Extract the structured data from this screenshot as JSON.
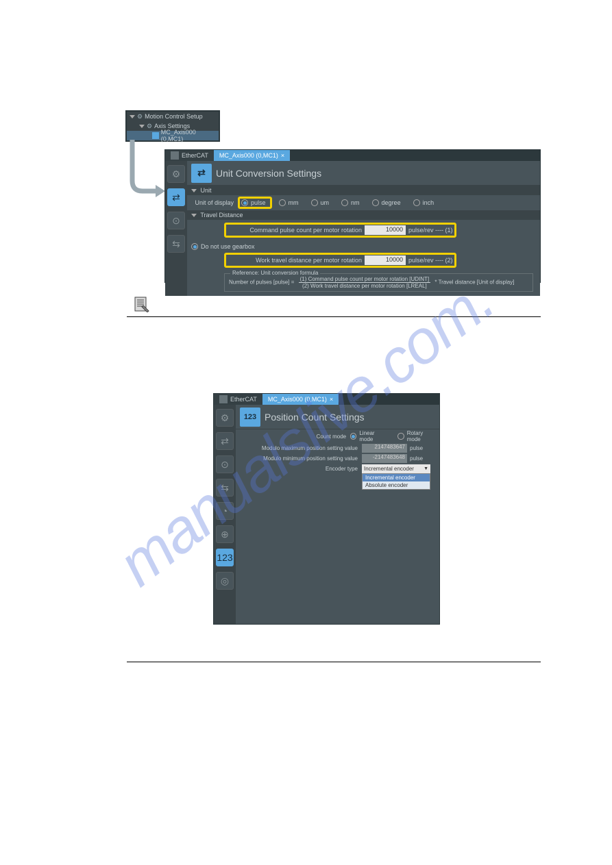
{
  "watermark": "manualslive.com.",
  "tree": {
    "motion_control": "Motion Control Setup",
    "axis_settings": "Axis Settings",
    "axis_node": "MC_Axis000 (0,MC1)"
  },
  "tabs": {
    "ethercat": "EtherCAT",
    "axis": "MC_Axis000 (0,MC1)",
    "close": "×"
  },
  "panel1": {
    "title": "Unit Conversion Settings",
    "section_unit": "Unit",
    "unit_of_display": "Unit of display",
    "radios": {
      "pulse": "pulse",
      "mm": "mm",
      "um": "um",
      "nm": "nm",
      "degree": "degree",
      "inch": "inch"
    },
    "section_travel": "Travel Distance",
    "cmd_pulse_label": "Command pulse count per motor rotation",
    "cmd_pulse_value": "10000",
    "cmd_pulse_unit": "pulse/rev ---- (1)",
    "no_gearbox": "Do not use gearbox",
    "work_travel_label": "Work travel distance per motor rotation",
    "work_travel_value": "10000",
    "work_travel_unit": "pulse/rev ---- (2)",
    "ref_legend": "Reference: Unit conversion formula",
    "formula_left": "Number of pulses [pulse] =",
    "formula_top": "(1) Command pulse count per motor rotation [UDINT]",
    "formula_bot": "(2) Work travel distance per motor rotation [LREAL]",
    "formula_right": "* Travel distance [Unit of display]"
  },
  "panel2": {
    "title": "Position Count Settings",
    "count_mode_label": "Count mode",
    "linear": "Linear mode",
    "rotary": "Rotary mode",
    "mod_max_label": "Modulo maximum position setting value",
    "mod_max_value": "2147483647",
    "mod_min_label": "Modulo minimum position setting value",
    "mod_min_value": "-2147483648",
    "pulse_unit": "pulse",
    "encoder_label": "Encoder type",
    "encoder_sel": "Incremental encoder",
    "dd_inc": "Incremental encoder",
    "dd_abs": "Absolute encoder"
  }
}
